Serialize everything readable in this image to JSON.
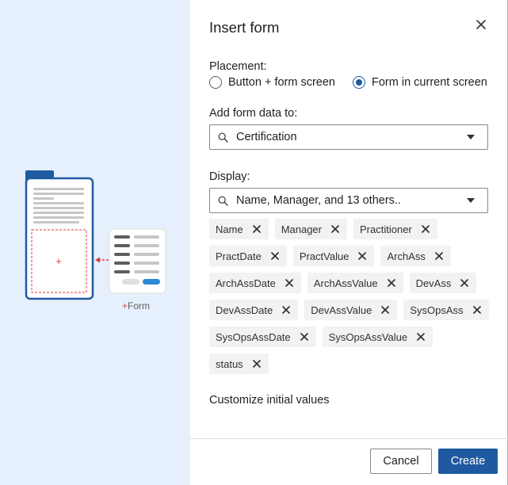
{
  "illustration": {
    "form_label": "Form",
    "form_plus": "+",
    "slot_plus": "+"
  },
  "dialog": {
    "title": "Insert form",
    "placement": {
      "label": "Placement:",
      "options": [
        {
          "label": "Button + form screen",
          "selected": false
        },
        {
          "label": "Form in current screen",
          "selected": true
        }
      ]
    },
    "data_source": {
      "label": "Add form data to:",
      "value": "Certification",
      "icon": "search-icon"
    },
    "display": {
      "label": "Display:",
      "value": "Name, Manager, and 13 others..",
      "icon": "search-icon",
      "fields": [
        "Name",
        "Manager",
        "Practitioner",
        "PractDate",
        "PractValue",
        "ArchAss",
        "ArchAssDate",
        "ArchAssValue",
        "DevAss",
        "DevAssDate",
        "DevAssValue",
        "SysOpsAss",
        "SysOpsAssDate",
        "SysOpsAssValue",
        "status"
      ]
    },
    "customize_link": "Customize initial values",
    "buttons": {
      "cancel": "Cancel",
      "create": "Create"
    }
  },
  "colors": {
    "accent": "#1f5aa0",
    "left_panel_bg": "#e5f0fc",
    "tag_bg": "#f3f2f1",
    "illustration_red": "#e0383e"
  }
}
